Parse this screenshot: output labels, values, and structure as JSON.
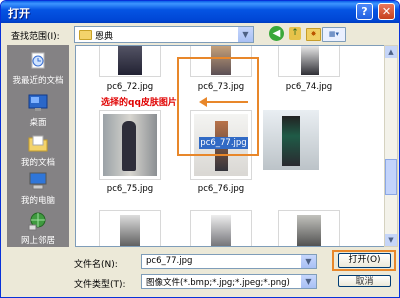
{
  "window": {
    "title": "打开"
  },
  "lookin": {
    "label": "查找范围(I):",
    "value": "恩典"
  },
  "toolbar": {
    "icons": [
      "back-icon",
      "up-folder-icon",
      "new-folder-icon",
      "views-icon"
    ]
  },
  "places": [
    {
      "label": "我最近的文档",
      "icon": "recent-documents-icon"
    },
    {
      "label": "桌面",
      "icon": "desktop-icon"
    },
    {
      "label": "我的文档",
      "icon": "my-documents-icon"
    },
    {
      "label": "我的电脑",
      "icon": "my-computer-icon"
    },
    {
      "label": "网上邻居",
      "icon": "network-places-icon"
    }
  ],
  "files": [
    {
      "name": "pc6_72.jpg"
    },
    {
      "name": "pc6_73.jpg"
    },
    {
      "name": "pc6_74.jpg"
    },
    {
      "name": "pc6_75.jpg"
    },
    {
      "name": "pc6_76.jpg"
    },
    {
      "name": "pc6_77.jpg",
      "selected": true
    }
  ],
  "annotation": "选择的qq皮肤图片",
  "filename": {
    "label": "文件名(N):",
    "value": "pc6_77.jpg"
  },
  "filetype": {
    "label": "文件类型(T):",
    "value": "图像文件(*.bmp;*.jpg;*.jpeg;*.png)"
  },
  "buttons": {
    "open": "打开(O)",
    "cancel": "取消"
  },
  "colors": {
    "titlebar": "#0054e3",
    "places_bg": "#848284",
    "selection": "#316ac5",
    "highlight": "#e8872a",
    "annotation": "#e00000"
  }
}
